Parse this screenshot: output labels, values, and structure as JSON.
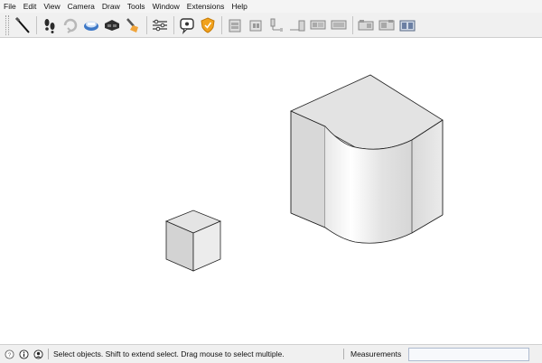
{
  "menubar": {
    "items": [
      "File",
      "Edit",
      "View",
      "Camera",
      "Draw",
      "Tools",
      "Window",
      "Extensions",
      "Help"
    ]
  },
  "toolbar": {
    "buttons": [
      {
        "icon": "select-arrow-icon"
      },
      {
        "icon": "footprints-icon"
      },
      {
        "icon": "orbit-icon"
      },
      {
        "icon": "pan-icon"
      },
      {
        "icon": "vr-goggles-icon"
      },
      {
        "icon": "paint-brush-icon"
      },
      {
        "icon": "settings-sliders-icon"
      },
      {
        "icon": "speech-bubble-icon"
      },
      {
        "icon": "shield-icon"
      },
      {
        "icon": "scene-tab-1-icon"
      },
      {
        "icon": "scene-tab-2-icon"
      },
      {
        "icon": "scene-tab-3-icon"
      },
      {
        "icon": "scene-tab-4-icon"
      },
      {
        "icon": "scene-tab-5-icon"
      },
      {
        "icon": "scene-tab-6-icon"
      },
      {
        "icon": "scene-tab-7-icon"
      },
      {
        "icon": "scene-tab-8-icon"
      },
      {
        "icon": "scene-tab-9-icon"
      }
    ]
  },
  "statusbar": {
    "message": "Select objects. Shift to extend select. Drag mouse to select multiple.",
    "measurements_label": "Measurements",
    "measurements_value": ""
  },
  "colors": {
    "face_top": "#e6e6e6",
    "face_left": "#d6d6d6",
    "face_right": "#ededed",
    "edge": "#222222"
  }
}
